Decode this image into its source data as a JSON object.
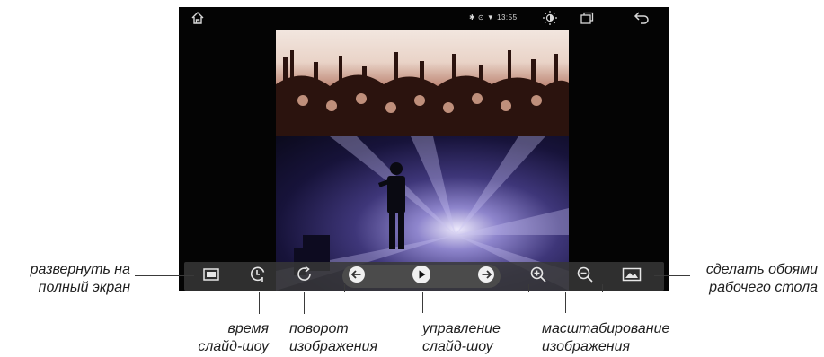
{
  "status_bar": {
    "status_text": "✱ ⊙ ▼ 13:55",
    "icons": [
      "home-icon",
      "brightness-icon",
      "recent-apps-icon",
      "back-icon"
    ]
  },
  "toolbar": {
    "buttons": [
      "fullscreen-icon",
      "slideshow-timer-icon",
      "rotate-icon",
      "previous-arrow-icon",
      "play-icon",
      "next-arrow-icon",
      "zoom-in-icon",
      "zoom-out-icon",
      "wallpaper-icon"
    ]
  },
  "annotations": {
    "fullscreen": [
      "развернуть на",
      "полный экран"
    ],
    "slideshow_time": [
      "время",
      "слайд-шоу"
    ],
    "rotate": [
      "поворот",
      "изображения"
    ],
    "slideshow_control": [
      "управление",
      "слайд-шоу"
    ],
    "zoom": [
      "масштабирование",
      "изображения"
    ],
    "wallpaper": [
      "сделать обоями",
      "рабочего стола"
    ]
  },
  "colors": {
    "screen_bg": "#040404",
    "toolbar_bg": "#373737",
    "icon": "#e6e6e6",
    "annotation_text": "#1e1e1e"
  }
}
